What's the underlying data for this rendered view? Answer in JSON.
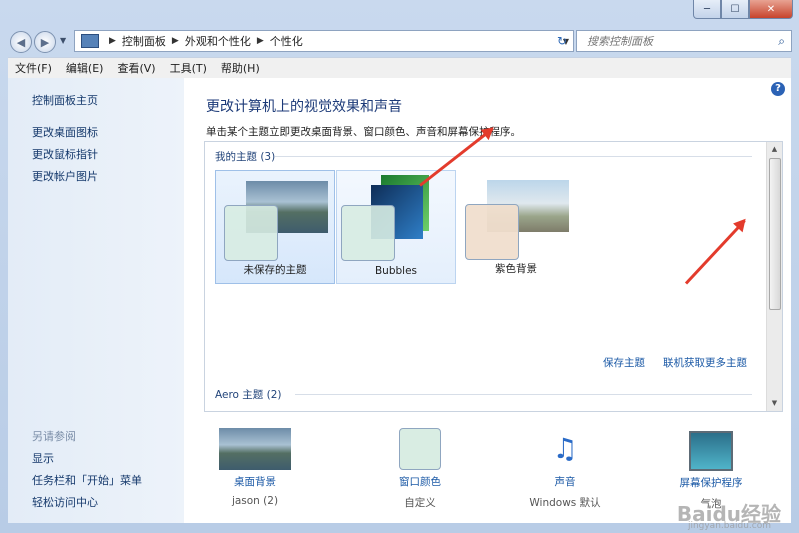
{
  "window": {
    "min_label": "─",
    "max_label": "☐",
    "close_label": "✕"
  },
  "address": {
    "crumbs": [
      "控制面板",
      "外观和个性化",
      "个性化"
    ],
    "refresh": "↻"
  },
  "search": {
    "placeholder": "搜索控制面板",
    "icon": "search-icon"
  },
  "menu": [
    "文件(F)",
    "编辑(E)",
    "查看(V)",
    "工具(T)",
    "帮助(H)"
  ],
  "sidebar": {
    "links": [
      "控制面板主页",
      "更改桌面图标",
      "更改鼠标指针",
      "更改帐户图片"
    ],
    "see_also": "另请参阅",
    "related": [
      "显示",
      "任务栏和「开始」菜单",
      "轻松访问中心"
    ]
  },
  "main": {
    "help": "?",
    "heading": "更改计算机上的视觉效果和声音",
    "description": "单击某个主题立即更改桌面背景、窗口颜色、声音和屏幕保护程序。",
    "my_themes_header": "我的主题 (3)",
    "my_themes": [
      "未保存的主题",
      "Bubbles",
      "紫色背景"
    ],
    "save_theme": "保存主题",
    "get_more": "联机获取更多主题",
    "aero_header": "Aero 主题 (2)"
  },
  "bottom": {
    "items": [
      {
        "title": "桌面背景",
        "sub": "jason (2)"
      },
      {
        "title": "窗口颜色",
        "sub": "自定义"
      },
      {
        "title": "声音",
        "sub": "Windows 默认"
      },
      {
        "title": "屏幕保护程序",
        "sub": "气泡"
      }
    ]
  },
  "watermark": {
    "brand": "Baidu经验",
    "url": "jingyan.baidu.com"
  }
}
